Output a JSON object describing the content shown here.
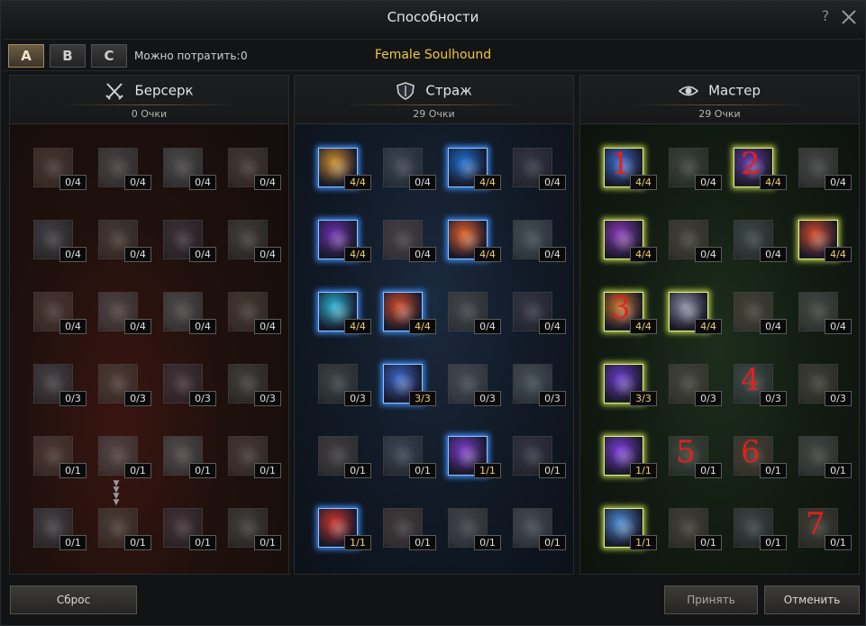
{
  "window": {
    "title": "Способности",
    "help": "?"
  },
  "topbar": {
    "presets": [
      "A",
      "B",
      "C"
    ],
    "active_preset": "A",
    "points_label": "Можно потратить:",
    "points_value": "0",
    "class_name": "Female Soulhound"
  },
  "columns": [
    {
      "id": "berserk",
      "title": "Берсерк",
      "icon": "crossed-swords-icon",
      "points": "0 Очки",
      "skills": [
        [
          "0/4",
          "0/4",
          "0/4",
          "0/4"
        ],
        [
          "0/4",
          "0/4",
          "0/4",
          "0/4"
        ],
        [
          "0/4",
          "0/4",
          "0/4",
          "0/4"
        ],
        [
          "0/3",
          "0/3",
          "0/3",
          "0/3"
        ],
        [
          "0/1",
          "0/1",
          "0/1",
          "0/1"
        ],
        [
          "0/1",
          "0/1",
          "0/1",
          "0/1"
        ]
      ],
      "learned": []
    },
    {
      "id": "guard",
      "title": "Страж",
      "icon": "shield-icon",
      "points": "29 Очки",
      "skills": [
        [
          "4/4",
          "0/4",
          "4/4",
          "0/4"
        ],
        [
          "4/4",
          "0/4",
          "4/4",
          "0/4"
        ],
        [
          "4/4",
          "4/4",
          "0/4",
          "0/4"
        ],
        [
          "0/3",
          "3/3",
          "0/3",
          "0/3"
        ],
        [
          "0/1",
          "0/1",
          "1/1",
          "0/1"
        ],
        [
          "1/1",
          "0/1",
          "0/1",
          "0/1"
        ]
      ],
      "learned": [
        [
          0,
          0
        ],
        [
          0,
          2
        ],
        [
          1,
          0
        ],
        [
          1,
          2
        ],
        [
          2,
          0
        ],
        [
          2,
          1
        ],
        [
          3,
          1
        ],
        [
          4,
          2
        ],
        [
          5,
          0
        ]
      ]
    },
    {
      "id": "master",
      "title": "Мастер",
      "icon": "eye-icon",
      "points": "29 Очки",
      "skills": [
        [
          "4/4",
          "0/4",
          "4/4",
          "0/4"
        ],
        [
          "4/4",
          "0/4",
          "0/4",
          "4/4"
        ],
        [
          "4/4",
          "4/4",
          "0/4",
          "0/4"
        ],
        [
          "3/3",
          "0/3",
          "0/3",
          "0/3"
        ],
        [
          "1/1",
          "0/1",
          "0/1",
          "0/1"
        ],
        [
          "1/1",
          "0/1",
          "0/1",
          "0/1"
        ]
      ],
      "learned": [
        [
          0,
          0
        ],
        [
          0,
          2
        ],
        [
          1,
          0
        ],
        [
          1,
          3
        ],
        [
          2,
          0
        ],
        [
          2,
          1
        ],
        [
          3,
          0
        ],
        [
          4,
          0
        ],
        [
          5,
          0
        ]
      ],
      "annotations": [
        {
          "row": 0,
          "col": 0,
          "text": "1"
        },
        {
          "row": 0,
          "col": 2,
          "text": "2"
        },
        {
          "row": 2,
          "col": 0,
          "text": "3"
        },
        {
          "row": 3,
          "col": 2,
          "text": "4"
        },
        {
          "row": 4,
          "col": 1,
          "text": "5"
        },
        {
          "row": 4,
          "col": 2,
          "text": "6"
        },
        {
          "row": 5,
          "col": 3,
          "text": "7"
        }
      ]
    }
  ],
  "footer": {
    "reset": "Сброс",
    "accept": "Принять",
    "cancel": "Отменить"
  },
  "colors": {
    "gold": "#f0c63a",
    "guard_glow": "#3d8fff",
    "master_glow": "#b8cf4a",
    "annotation": "#e0221e"
  }
}
